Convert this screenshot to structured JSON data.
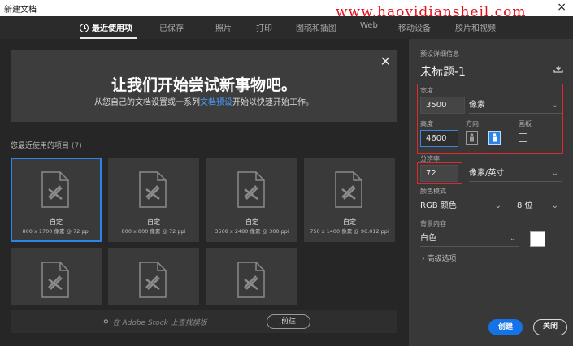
{
  "window": {
    "title": "新建文档",
    "close_glyph": "×"
  },
  "watermark": "www.haoyidianshejl.com",
  "tabs": [
    {
      "label": "最近使用项",
      "active": true
    },
    {
      "label": "已保存"
    },
    {
      "label": "照片"
    },
    {
      "label": "打印"
    },
    {
      "label": "图稿和插图"
    },
    {
      "label": "Web"
    },
    {
      "label": "移动设备"
    },
    {
      "label": "胶片和视频"
    }
  ],
  "banner": {
    "headline": "让我们开始尝试新事物吧。",
    "subtitle_before": "从您自己的文档设置或一系列",
    "subtitle_link": "文档预设",
    "subtitle_after": "开始以快速开始工作。"
  },
  "recent": {
    "label": "您最近使用的项目",
    "count": "(7)",
    "items": [
      {
        "name": "自定",
        "meta": "800 x 1700 像素 @ 72 ppi"
      },
      {
        "name": "自定",
        "meta": "800 x 800 像素 @ 72 ppi"
      },
      {
        "name": "自定",
        "meta": "3508 x 2480 像素 @ 300 ppi"
      },
      {
        "name": "自定",
        "meta": "750 x 1400 像素 @ 96.012 ppi"
      }
    ]
  },
  "stock": {
    "placeholder": "在 Adobe Stock 上查找模板",
    "go_label": "前往"
  },
  "panel": {
    "section_label": "预设详细信息",
    "doc_title": "未标题-1",
    "width": {
      "label": "宽度",
      "value": "3500",
      "unit": "像素"
    },
    "height": {
      "label": "高度",
      "value": "4600"
    },
    "orientation": {
      "label": "方向",
      "selected": "portrait"
    },
    "artboard": {
      "label": "画板",
      "checked": false
    },
    "resolution": {
      "label": "分辨率",
      "value": "72",
      "unit": "像素/英寸"
    },
    "color_mode": {
      "label": "颜色模式",
      "value": "RGB 颜色",
      "depth": "8 位"
    },
    "background": {
      "label": "背景内容",
      "value": "白色",
      "swatch": "#ffffff"
    },
    "advanced_label": "高级选项",
    "create_label": "创建",
    "close_label": "关闭"
  },
  "colors": {
    "accent": "#1473e6",
    "highlight_box": "#e0292e",
    "watermark": "#e0101a"
  }
}
